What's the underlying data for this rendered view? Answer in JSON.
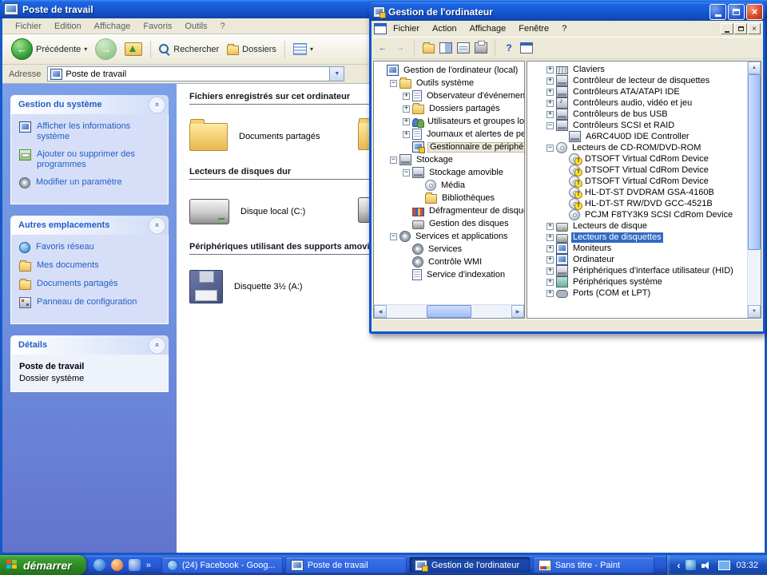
{
  "bw": {
    "title": "Poste de travail",
    "menu": [
      "Fichier",
      "Edition",
      "Affichage",
      "Favoris",
      "Outils",
      "?"
    ],
    "toolbar": {
      "back": "Précédente",
      "search": "Rechercher",
      "folders": "Dossiers"
    },
    "address": {
      "label": "Adresse",
      "value": "Poste de travail"
    },
    "sidebar": {
      "panels": [
        {
          "title": "Gestion du système",
          "items": [
            {
              "icon": "sysinfo-icon",
              "label": "Afficher les informations système"
            },
            {
              "icon": "addremove-icon",
              "label": "Ajouter ou supprimer des programmes"
            },
            {
              "icon": "param-icon",
              "label": "Modifier un paramètre"
            }
          ]
        },
        {
          "title": "Autres emplacements",
          "items": [
            {
              "icon": "network-icon",
              "label": "Favoris réseau"
            },
            {
              "icon": "folder-icon",
              "label": "Mes documents"
            },
            {
              "icon": "folder-icon",
              "label": "Documents partagés"
            },
            {
              "icon": "control-icon",
              "label": "Panneau de configuration"
            }
          ]
        },
        {
          "title": "Détails"
        }
      ],
      "details": {
        "name": "Poste de travail",
        "type": "Dossier système"
      }
    },
    "content": {
      "sections": [
        {
          "heading": "Fichiers enregistrés sur cet ordinateur",
          "items": [
            {
              "icon": "folder",
              "label": "Documents partagés"
            }
          ],
          "partial_icon": "folder"
        },
        {
          "heading": "Lecteurs de disques dur",
          "items": [
            {
              "icon": "disk",
              "label": "Disque local (C:)"
            }
          ],
          "partial_icon": "disk"
        },
        {
          "heading": "Périphériques utilisant des supports amovibles",
          "items": [
            {
              "icon": "floppy",
              "label": "Disquette 3½ (A:)"
            }
          ]
        }
      ]
    }
  },
  "fw": {
    "title": "Gestion de l'ordinateur",
    "menu": [
      "Fichier",
      "Action",
      "Affichage",
      "Fenêtre",
      "?"
    ],
    "tree": [
      {
        "d": 0,
        "e": "",
        "i": "computer",
        "l": "Gestion de l'ordinateur (local)"
      },
      {
        "d": 1,
        "e": "-",
        "i": "folder",
        "l": "Outils système"
      },
      {
        "d": 2,
        "e": "+",
        "i": "event",
        "l": "Observateur d'événements"
      },
      {
        "d": 2,
        "e": "+",
        "i": "shared",
        "l": "Dossiers partagés"
      },
      {
        "d": 2,
        "e": "+",
        "i": "users",
        "l": "Utilisateurs et groupes locaux"
      },
      {
        "d": 2,
        "e": "+",
        "i": "perf",
        "l": "Journaux et alertes de perfo"
      },
      {
        "d": 2,
        "e": "",
        "i": "devmgr",
        "l": "Gestionnaire de périphériques",
        "sel": true
      },
      {
        "d": 1,
        "e": "-",
        "i": "storage",
        "l": "Stockage"
      },
      {
        "d": 2,
        "e": "-",
        "i": "removable",
        "l": "Stockage amovible"
      },
      {
        "d": 3,
        "e": "",
        "i": "media",
        "l": "Média"
      },
      {
        "d": 3,
        "e": "",
        "i": "libraries",
        "l": "Bibliothèques"
      },
      {
        "d": 2,
        "e": "",
        "i": "defrag",
        "l": "Défragmenteur de disque"
      },
      {
        "d": 2,
        "e": "",
        "i": "diskmgmt",
        "l": "Gestion des disques"
      },
      {
        "d": 1,
        "e": "-",
        "i": "servapps",
        "l": "Services et applications"
      },
      {
        "d": 2,
        "e": "",
        "i": "services",
        "l": "Services"
      },
      {
        "d": 2,
        "e": "",
        "i": "wmi",
        "l": "Contrôle WMI"
      },
      {
        "d": 2,
        "e": "",
        "i": "indexing",
        "l": "Service d'indexation"
      }
    ],
    "devices": [
      {
        "d": 1,
        "e": "+",
        "i": "keyboard",
        "l": "Claviers"
      },
      {
        "d": 1,
        "e": "+",
        "i": "card",
        "l": "Contrôleur de lecteur de disquettes"
      },
      {
        "d": 1,
        "e": "+",
        "i": "card",
        "l": "Contrôleurs ATA/ATAPI IDE"
      },
      {
        "d": 1,
        "e": "+",
        "i": "audio",
        "l": "Contrôleurs audio, vidéo et jeu"
      },
      {
        "d": 1,
        "e": "+",
        "i": "usb",
        "l": "Contrôleurs de bus USB"
      },
      {
        "d": 1,
        "e": "-",
        "i": "card",
        "l": "Contrôleurs SCSI et RAID"
      },
      {
        "d": 2,
        "e": "",
        "i": "card",
        "l": "A6RC4U0D IDE Controller"
      },
      {
        "d": 1,
        "e": "-",
        "i": "cd",
        "l": "Lecteurs de CD-ROM/DVD-ROM"
      },
      {
        "d": 2,
        "e": "",
        "i": "cdwarn",
        "l": "DTSOFT Virtual CdRom Device"
      },
      {
        "d": 2,
        "e": "",
        "i": "cdwarn",
        "l": "DTSOFT Virtual CdRom Device"
      },
      {
        "d": 2,
        "e": "",
        "i": "cdwarn",
        "l": "DTSOFT Virtual CdRom Device"
      },
      {
        "d": 2,
        "e": "",
        "i": "cdwarn",
        "l": "HL-DT-ST DVDRAM GSA-4160B"
      },
      {
        "d": 2,
        "e": "",
        "i": "cdwarn",
        "l": "HL-DT-ST RW/DVD GCC-4521B"
      },
      {
        "d": 2,
        "e": "",
        "i": "cd",
        "l": "PCJM F8TY3K9 SCSI CdRom Device"
      },
      {
        "d": 1,
        "e": "+",
        "i": "disk",
        "l": "Lecteurs de disque"
      },
      {
        "d": 1,
        "e": "+",
        "i": "floppy",
        "l": "Lecteurs de disquettes",
        "sel": true
      },
      {
        "d": 1,
        "e": "+",
        "i": "monitor",
        "l": "Moniteurs"
      },
      {
        "d": 1,
        "e": "+",
        "i": "computer",
        "l": "Ordinateur"
      },
      {
        "d": 1,
        "e": "+",
        "i": "hid",
        "l": "Périphériques d'interface utilisateur (HID)"
      },
      {
        "d": 1,
        "e": "+",
        "i": "system",
        "l": "Périphériques système"
      },
      {
        "d": 1,
        "e": "+",
        "i": "ports",
        "l": "Ports (COM et LPT)"
      }
    ]
  },
  "taskbar": {
    "start": "démarrer",
    "tasks": [
      {
        "icon": "browser",
        "label": "(24) Facebook - Goog...",
        "active": false
      },
      {
        "icon": "computer",
        "label": "Poste de travail",
        "active": false
      },
      {
        "icon": "mmc",
        "label": "Gestion de l'ordinateur",
        "active": true
      },
      {
        "icon": "paint",
        "label": "Sans titre - Paint",
        "active": false
      }
    ],
    "clock": "03:32"
  }
}
